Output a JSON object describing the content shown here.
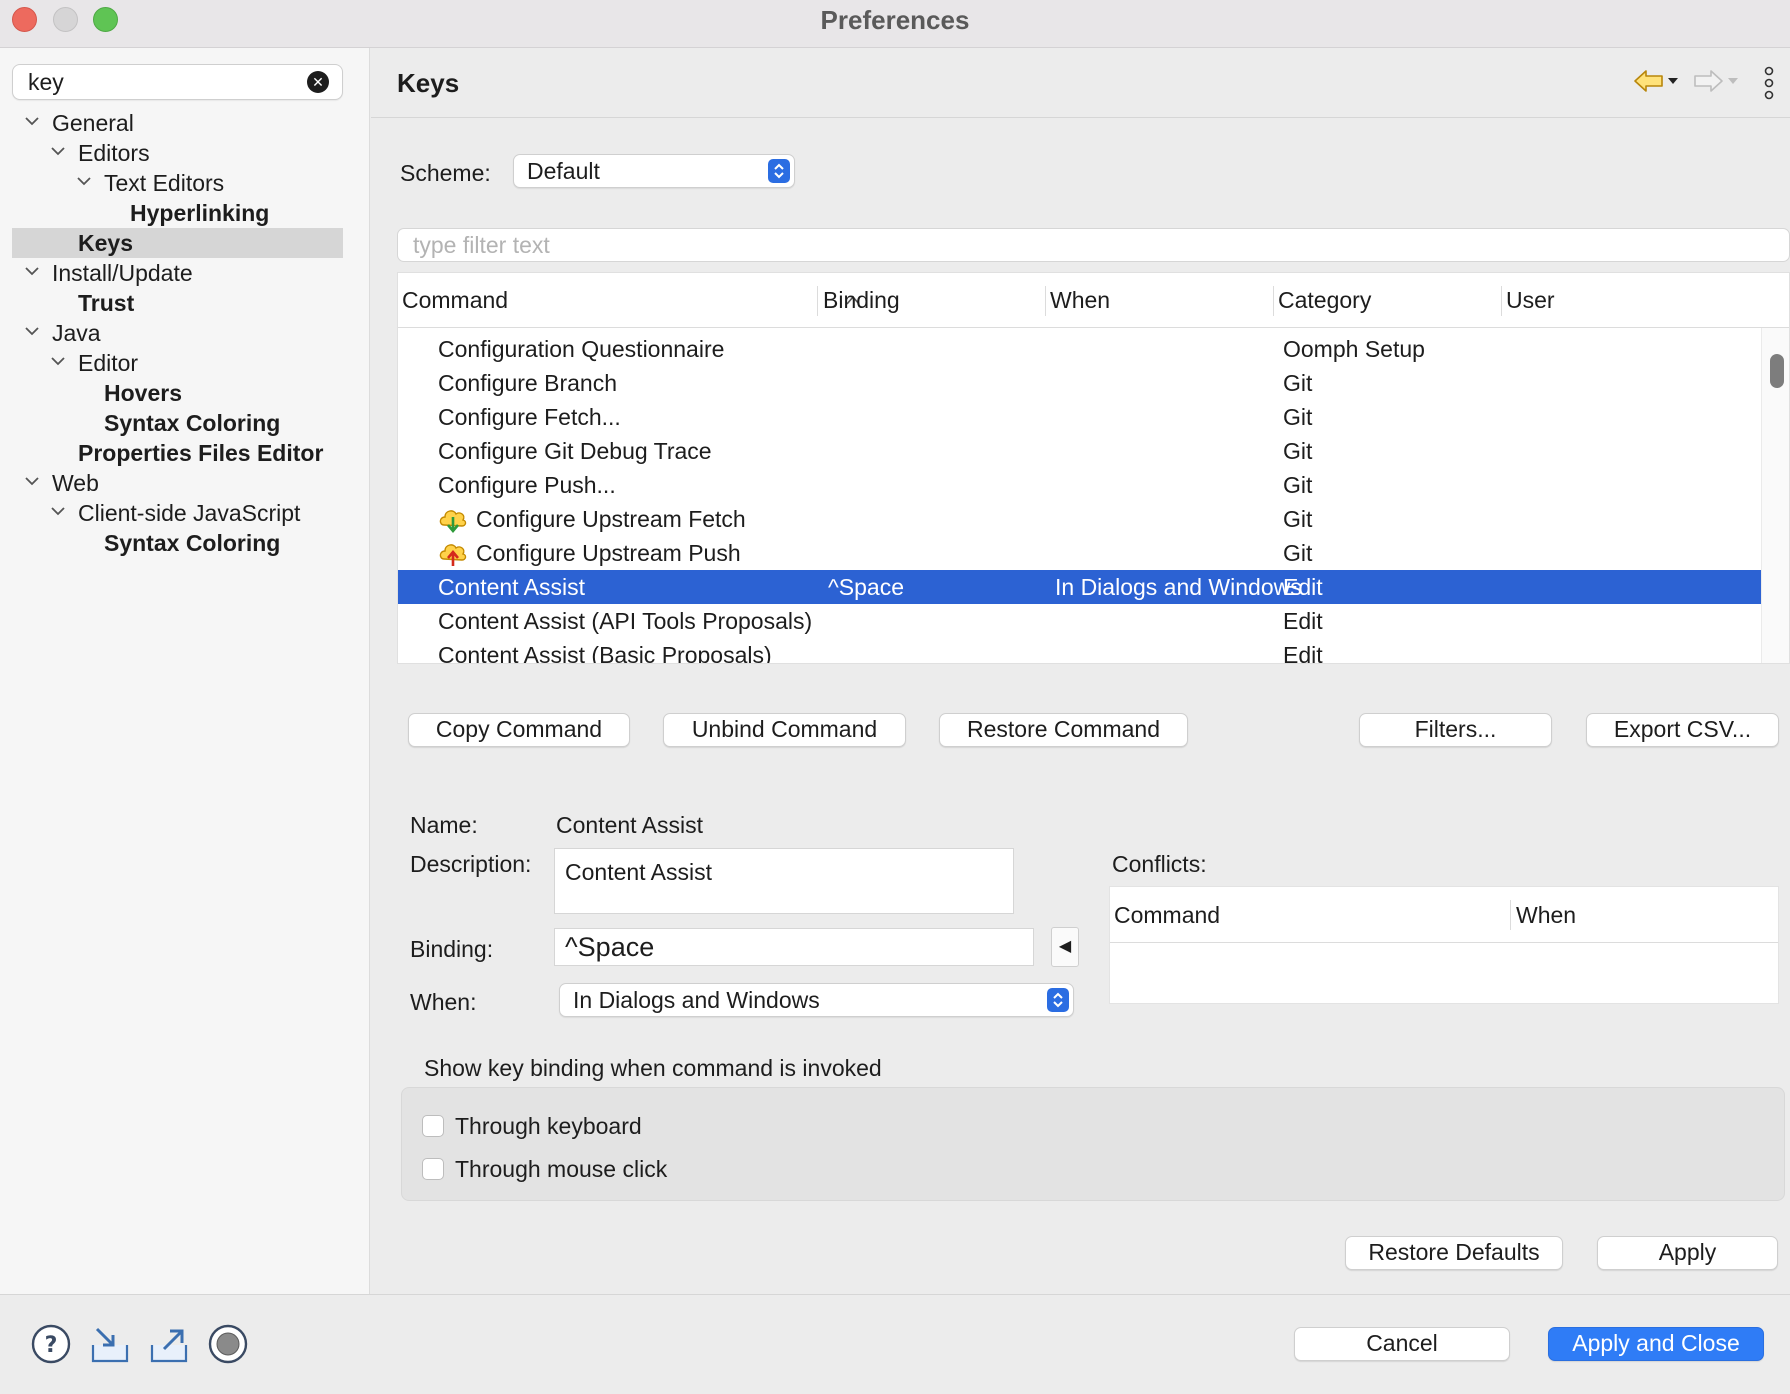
{
  "window": {
    "title": "Preferences"
  },
  "sidebar": {
    "search_value": "key",
    "tree": [
      {
        "label": "General",
        "level": 0,
        "expanded": true,
        "bold": false
      },
      {
        "label": "Editors",
        "level": 1,
        "expanded": true,
        "bold": false
      },
      {
        "label": "Text Editors",
        "level": 2,
        "expanded": true,
        "bold": false
      },
      {
        "label": "Hyperlinking",
        "level": 3,
        "bold": true
      },
      {
        "label": "Keys",
        "level": 1,
        "bold": true,
        "selected": true
      },
      {
        "label": "Install/Update",
        "level": 0,
        "expanded": true,
        "bold": false
      },
      {
        "label": "Trust",
        "level": 1,
        "bold": true
      },
      {
        "label": "Java",
        "level": 0,
        "expanded": true,
        "bold": false
      },
      {
        "label": "Editor",
        "level": 1,
        "expanded": true,
        "bold": false
      },
      {
        "label": "Hovers",
        "level": 2,
        "bold": true
      },
      {
        "label": "Syntax Coloring",
        "level": 2,
        "bold": true
      },
      {
        "label": "Properties Files Editor",
        "level": 1,
        "bold": true
      },
      {
        "label": "Web",
        "level": 0,
        "expanded": true,
        "bold": false
      },
      {
        "label": "Client-side JavaScript",
        "level": 1,
        "expanded": true,
        "bold": false
      },
      {
        "label": "Syntax Coloring",
        "level": 2,
        "bold": true
      }
    ]
  },
  "page": {
    "title": "Keys",
    "scheme_label": "Scheme:",
    "scheme_value": "Default",
    "filter_placeholder": "type filter text"
  },
  "table": {
    "columns": [
      "Command",
      "Binding",
      "When",
      "Category",
      "User"
    ],
    "rows": [
      {
        "command": "Configuration Questionnaire",
        "binding": "",
        "when": "",
        "category": "Oomph Setup",
        "user": "",
        "icon": ""
      },
      {
        "command": "Configure Branch",
        "binding": "",
        "when": "",
        "category": "Git",
        "user": "",
        "icon": ""
      },
      {
        "command": "Configure Fetch...",
        "binding": "",
        "when": "",
        "category": "Git",
        "user": "",
        "icon": ""
      },
      {
        "command": "Configure Git Debug Trace",
        "binding": "",
        "when": "",
        "category": "Git",
        "user": "",
        "icon": ""
      },
      {
        "command": "Configure Push...",
        "binding": "",
        "when": "",
        "category": "Git",
        "user": "",
        "icon": ""
      },
      {
        "command": "Configure Upstream Fetch",
        "binding": "",
        "when": "",
        "category": "Git",
        "user": "",
        "icon": "cloud-fetch-icon"
      },
      {
        "command": "Configure Upstream Push",
        "binding": "",
        "when": "",
        "category": "Git",
        "user": "",
        "icon": "cloud-push-icon"
      },
      {
        "command": "Content Assist",
        "binding": "^Space",
        "when": "In Dialogs and Windows",
        "category": "Edit",
        "user": "",
        "icon": "",
        "selected": true
      },
      {
        "command": "Content Assist (API Tools Proposals)",
        "binding": "",
        "when": "",
        "category": "Edit",
        "user": "",
        "icon": ""
      },
      {
        "command": "Content Assist (Basic Proposals)",
        "binding": "",
        "when": "",
        "category": "Edit",
        "user": "",
        "icon": ""
      }
    ]
  },
  "actions": {
    "copy_command": "Copy Command",
    "unbind_command": "Unbind Command",
    "restore_command": "Restore Command",
    "filters": "Filters...",
    "export_csv": "Export CSV..."
  },
  "details": {
    "name_label": "Name:",
    "name_value": "Content Assist",
    "description_label": "Description:",
    "description_value": "Content Assist",
    "binding_label": "Binding:",
    "binding_value": "^Space",
    "binding_arrow": "◀",
    "when_label": "When:",
    "when_value": "In Dialogs and Windows",
    "conflicts_label": "Conflicts:",
    "conflicts_columns": [
      "Command",
      "When"
    ]
  },
  "show_binding": {
    "title": "Show key binding when command is invoked",
    "through_keyboard": "Through keyboard",
    "through_mouse": "Through mouse click",
    "keyboard_checked": false,
    "mouse_checked": false
  },
  "page_buttons": {
    "restore_defaults": "Restore Defaults",
    "apply": "Apply"
  },
  "footer": {
    "cancel": "Cancel",
    "apply_and_close": "Apply and Close",
    "icons": [
      "help-icon",
      "import-icon",
      "export-icon",
      "record-icon"
    ]
  },
  "colors": {
    "selection": "#2c62d3",
    "primary_button": "#2f7cf6",
    "select_arrow": "#2b6de2",
    "back_arrow": "#d9a400"
  }
}
